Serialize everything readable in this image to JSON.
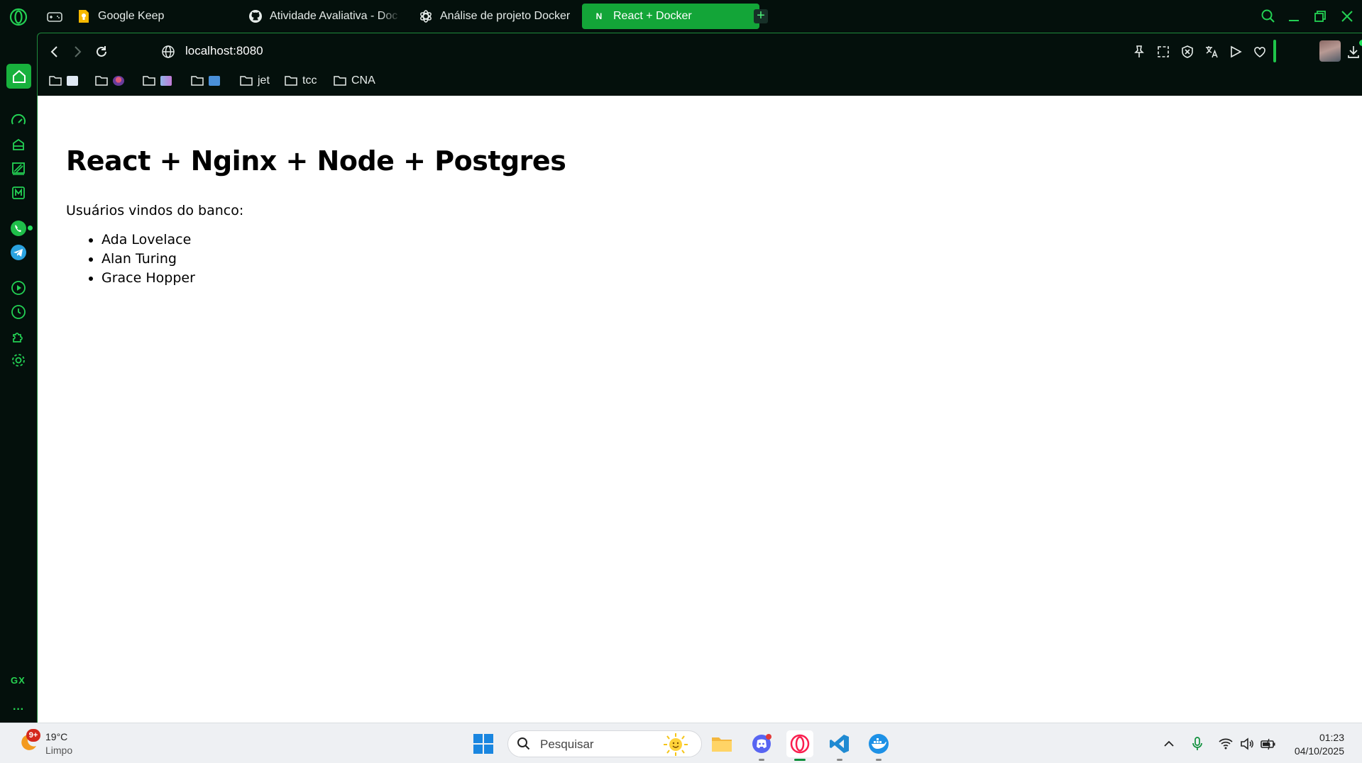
{
  "browser": {
    "tabs": [
      {
        "label": "Google Keep",
        "icon": "google-keep-icon"
      },
      {
        "label": "Atividade Avaliativa - Doc",
        "icon": "github-icon"
      },
      {
        "label": "Análise de projeto Docker",
        "icon": "chatgpt-icon"
      },
      {
        "label": "React + Docker",
        "icon": "react-n-icon",
        "active": true,
        "icon_letter": "N"
      }
    ],
    "new_tab": "+",
    "address": {
      "host": "localhost:8080"
    },
    "accent_color": "#13a538",
    "bookmarks": [
      {
        "label": "",
        "icon": "folder-icon"
      },
      {
        "label": "",
        "icon": "folder-icon"
      },
      {
        "label": "",
        "icon": "folder-icon"
      },
      {
        "label": "",
        "icon": "folder-icon"
      },
      {
        "label": "jet",
        "icon": "folder-icon"
      },
      {
        "label": "tcc",
        "icon": "folder-icon"
      },
      {
        "label": "CNA",
        "icon": "folder-icon"
      }
    ],
    "sidebar": {
      "gx_label": "GX",
      "more_label": "···"
    }
  },
  "page": {
    "heading": "React + Nginx + Node + Postgres",
    "intro": "Usuários vindos do banco:",
    "users": [
      "Ada Lovelace",
      "Alan Turing",
      "Grace Hopper"
    ]
  },
  "taskbar": {
    "weather": {
      "badge": "9+",
      "temp": "19°C",
      "condition": "Limpo"
    },
    "search_placeholder": "Pesquisar",
    "clock": {
      "time": "01:23",
      "date": "04/10/2025"
    },
    "apps": [
      "file-explorer-icon",
      "discord-icon",
      "opera-gx-icon",
      "vscode-icon",
      "docker-icon"
    ]
  }
}
